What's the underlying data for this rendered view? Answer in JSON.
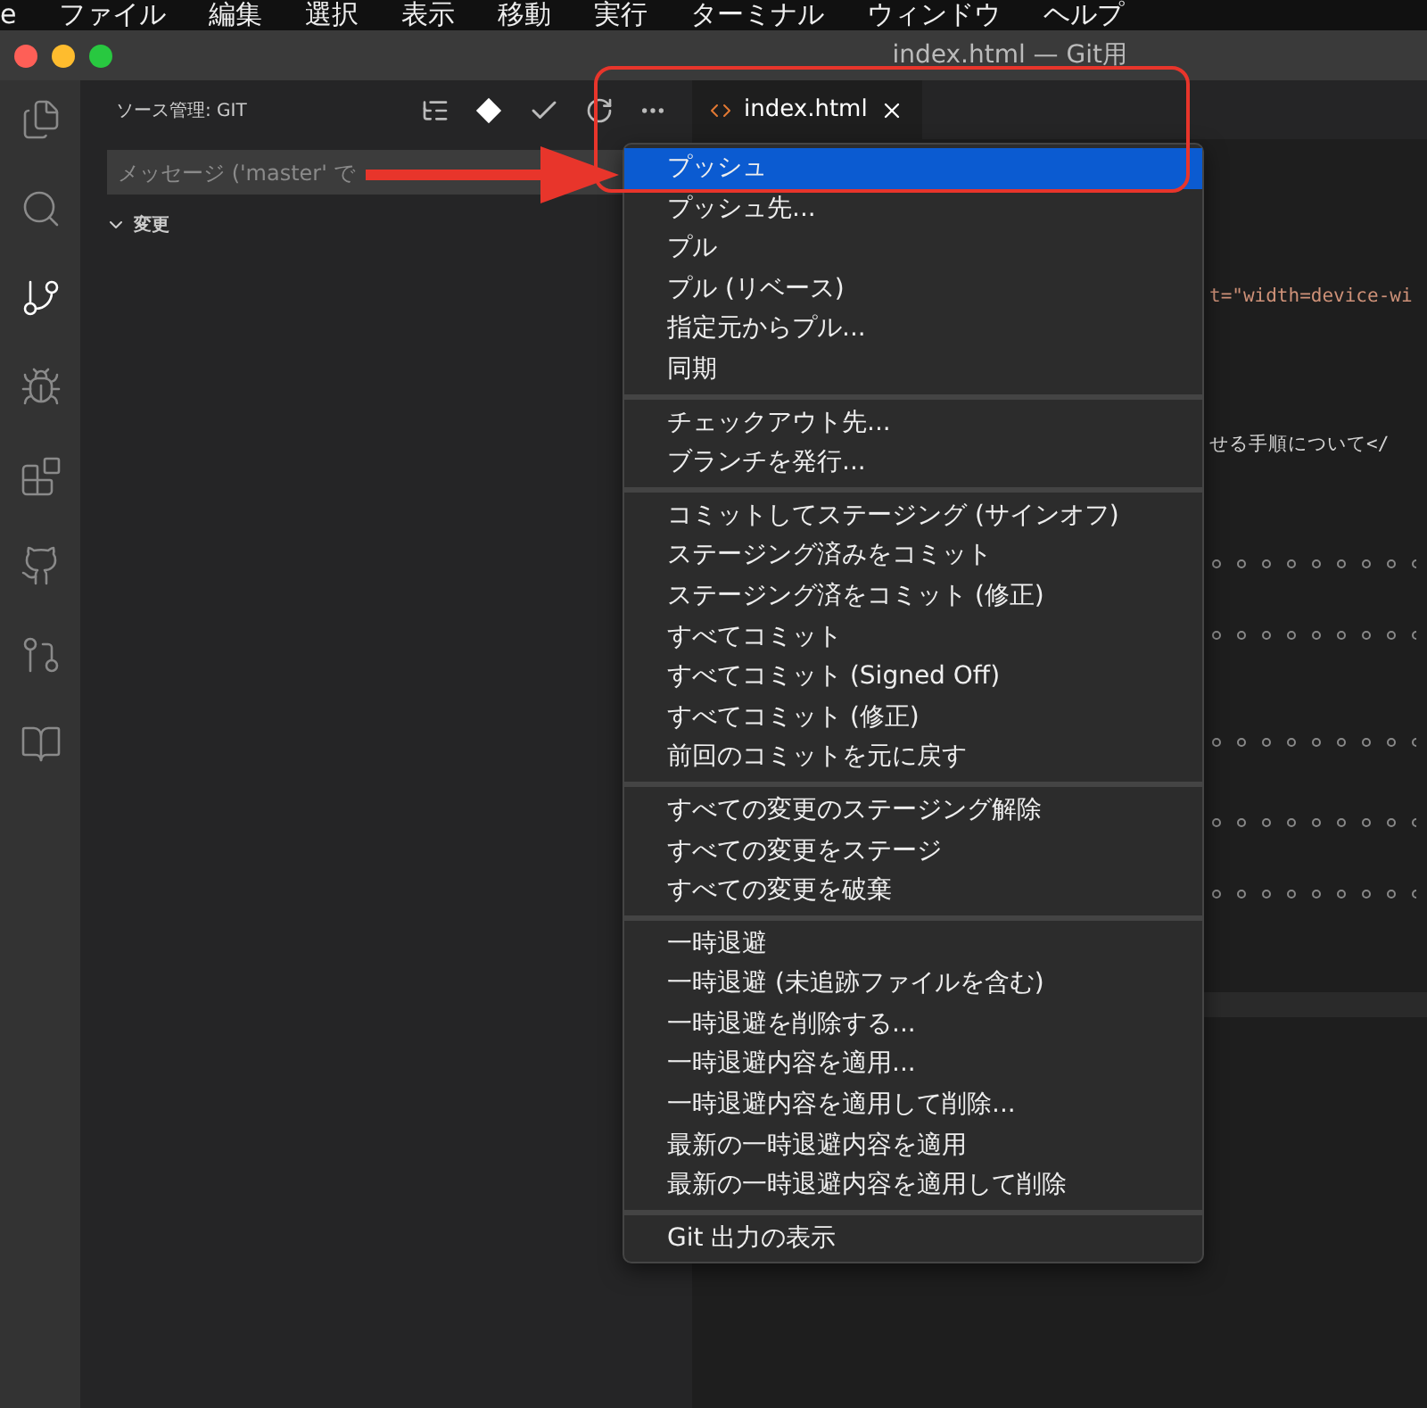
{
  "menu_bar": [
    "e",
    "ファイル",
    "編集",
    "選択",
    "表示",
    "移動",
    "実行",
    "ターミナル",
    "ウィンドウ",
    "ヘルプ"
  ],
  "window": {
    "title": "index.html — Git用"
  },
  "activity_bar": [
    {
      "kind": "files",
      "selected": false
    },
    {
      "kind": "search",
      "selected": false
    },
    {
      "kind": "scm",
      "selected": true
    },
    {
      "kind": "debug",
      "selected": false
    },
    {
      "kind": "extensions",
      "selected": false
    },
    {
      "kind": "github",
      "selected": false
    },
    {
      "kind": "pr",
      "selected": false
    },
    {
      "kind": "book",
      "selected": false
    }
  ],
  "sidebar": {
    "title": "ソース管理: GIT",
    "message": {
      "placeholder": "メッセージ ('master' で"
    },
    "section": {
      "label": "変更",
      "expanded": true
    }
  },
  "tabs": [
    {
      "label": "index.html",
      "selected": true
    }
  ],
  "editor": {
    "lines": [
      {
        "kind": "attr",
        "text": "t=\"width=device-wi"
      },
      {
        "kind": "text",
        "text": "せる手順について</"
      },
      {
        "kind": "dots"
      },
      {
        "kind": "dots"
      },
      {
        "kind": "dots"
      },
      {
        "kind": "dots"
      },
      {
        "kind": "dots"
      }
    ]
  },
  "context_menu": [
    [
      {
        "label": "プッシュ",
        "selected": true
      },
      {
        "label": "プッシュ先...",
        "selected": false
      },
      {
        "label": "プル",
        "selected": false
      },
      {
        "label": "プル (リベース)",
        "selected": false
      },
      {
        "label": "指定元からプル...",
        "selected": false
      },
      {
        "label": "同期",
        "selected": false
      }
    ],
    [
      {
        "label": "チェックアウト先...",
        "selected": false
      },
      {
        "label": "ブランチを発行...",
        "selected": false
      }
    ],
    [
      {
        "label": "コミットしてステージング (サインオフ)",
        "selected": false
      },
      {
        "label": "ステージング済みをコミット",
        "selected": false
      },
      {
        "label": "ステージング済をコミット (修正)",
        "selected": false
      },
      {
        "label": "すべてコミット",
        "selected": false
      },
      {
        "label": "すべてコミット (Signed Off)",
        "selected": false
      },
      {
        "label": "すべてコミット (修正)",
        "selected": false
      },
      {
        "label": "前回のコミットを元に戻す",
        "selected": false
      }
    ],
    [
      {
        "label": "すべての変更のステージング解除",
        "selected": false
      },
      {
        "label": "すべての変更をステージ",
        "selected": false
      },
      {
        "label": "すべての変更を破棄",
        "selected": false
      }
    ],
    [
      {
        "label": "一時退避",
        "selected": false
      },
      {
        "label": "一時退避 (未追跡ファイルを含む)",
        "selected": false
      },
      {
        "label": "一時退避を削除する...",
        "selected": false
      },
      {
        "label": "一時退避内容を適用...",
        "selected": false
      },
      {
        "label": "一時退避内容を適用して削除...",
        "selected": false
      },
      {
        "label": "最新の一時退避内容を適用",
        "selected": false
      },
      {
        "label": "最新の一時退避内容を適用して削除",
        "selected": false
      }
    ],
    [
      {
        "label": "Git 出力の表示",
        "selected": false
      }
    ]
  ]
}
